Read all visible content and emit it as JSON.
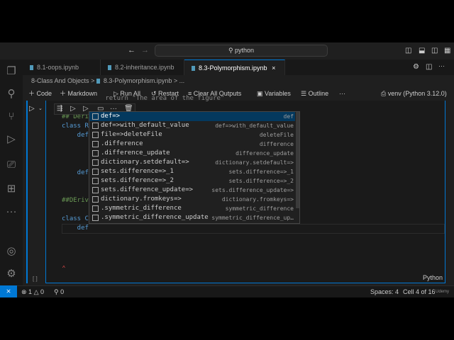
{
  "title": {
    "search": "python",
    "nav_back": "←",
    "nav_fwd": "→"
  },
  "tabs": [
    {
      "label": "8.1-oops.ipynb"
    },
    {
      "label": "8.2-inheritance.ipynb"
    },
    {
      "label": "8.3-Polymorphism.ipynb",
      "active": true,
      "close": "×"
    }
  ],
  "breadcrumb": {
    "folder": "8-Class And Objects",
    "sep": ">",
    "file": "8.3-Polymorphism.ipynb",
    "more": "> ..."
  },
  "toolbar": {
    "code": "Code",
    "markdown": "Markdown",
    "run_all": "Run All",
    "restart": "Restart",
    "clear": "Clear All Outputs",
    "variables": "Variables",
    "outline": "Outline",
    "more": "···",
    "kernel": "venv (Python 3.12.0)"
  },
  "code": {
    "line0": "        return \"The area of the figure\"",
    "line1a": "## Deri",
    "line2a": "class R",
    "line3a": "    def",
    "line7a": "    def",
    "line10a": "##DEriv",
    "line12a": "class C",
    "line13a": "    def"
  },
  "suggestions": [
    {
      "label": "def=>",
      "detail": "def"
    },
    {
      "label": "def=>with_default_value",
      "detail": "def=>with_default_value"
    },
    {
      "label": "file=>deleteFile",
      "detail": "deleteFile"
    },
    {
      "label": ".difference",
      "detail": "difference"
    },
    {
      "label": ".difference_update",
      "detail": "difference_update"
    },
    {
      "label": "dictionary.setdefault=>",
      "detail": "dictionary.setdefault=>"
    },
    {
      "label": "sets.difference=>_1",
      "detail": "sets.difference=>_1"
    },
    {
      "label": "sets.difference=>_2",
      "detail": "sets.difference=>_2"
    },
    {
      "label": "sets.difference_update=>",
      "detail": "sets.difference_update=>"
    },
    {
      "label": "dictionary.fromkeys=>",
      "detail": "dictionary.fromkeys=>"
    },
    {
      "label": ".symmetric_difference",
      "detail": "symmetric_difference"
    },
    {
      "label": ".symmetric_difference_update",
      "detail": "symmetric_difference_up…"
    }
  ],
  "cell": {
    "exec_count": "[ ]",
    "language": "Python"
  },
  "status": {
    "errors": "1",
    "warnings": "0",
    "ports": "0",
    "spaces": "Spaces: 4",
    "cell": "Cell 4 of 16",
    "watermark": "Udemy"
  }
}
